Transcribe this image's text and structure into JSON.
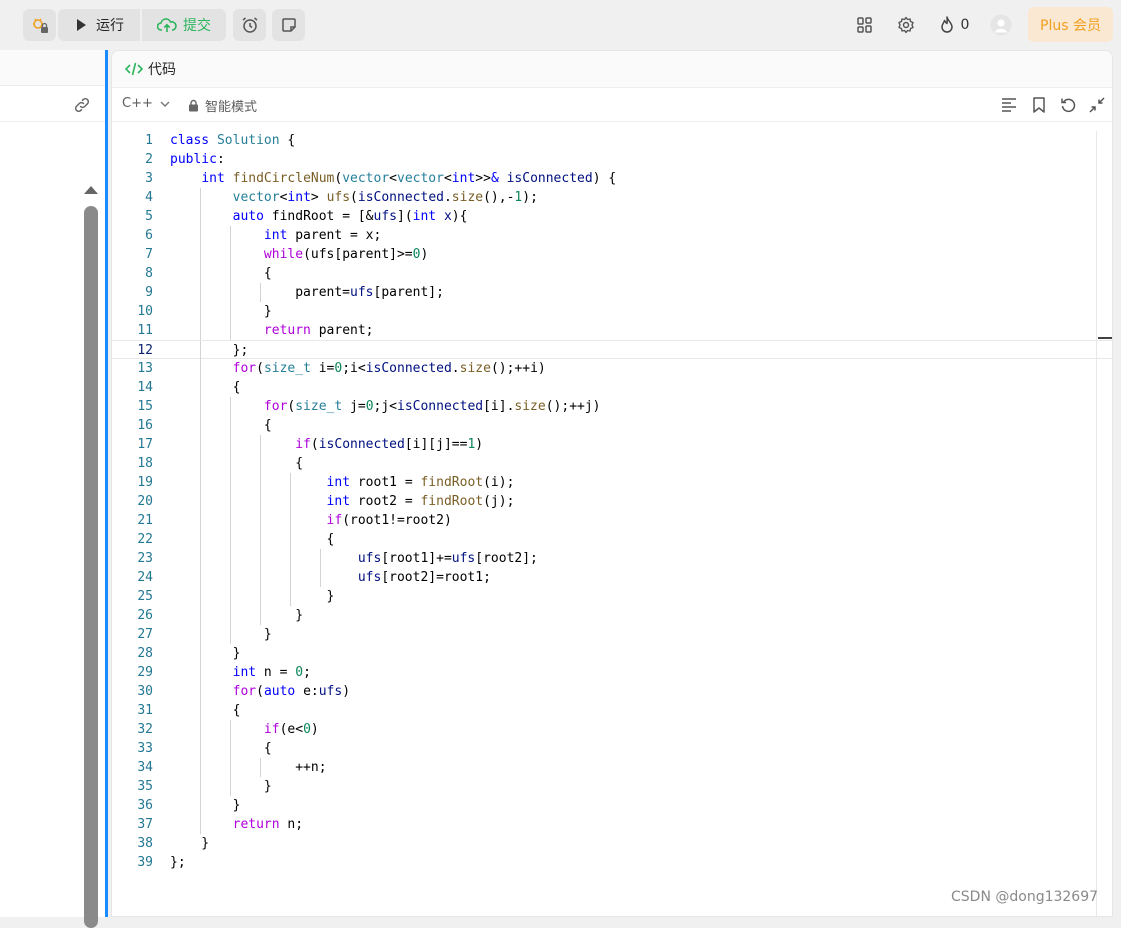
{
  "toolbar": {
    "run_label": "运行",
    "submit_label": "提交",
    "streak_count": "0",
    "plus_label": "Plus 会员"
  },
  "editor": {
    "title": "代码",
    "language": "C++",
    "mode": "智能模式",
    "active_line": 12,
    "lines": [
      {
        "n": "1",
        "indent": 0,
        "html": "<span class=\"kw\">class</span> <span class=\"ty\">Solution</span> {"
      },
      {
        "n": "2",
        "indent": 0,
        "html": "<span class=\"kw\">public</span>:"
      },
      {
        "n": "3",
        "indent": 1,
        "html": "    <span class=\"kw\">int</span> <span class=\"fn\">findCircleNum</span>(<span class=\"ty\">vector</span>&lt;<span class=\"ty\">vector</span>&lt;<span class=\"kw\">int</span>&gt;&gt;<span class=\"kw\">&amp;</span> <span class=\"var\">isConnected</span>) {"
      },
      {
        "n": "4",
        "indent": 2,
        "html": "        <span class=\"ty\">vector</span>&lt;<span class=\"kw\">int</span>&gt; <span class=\"fn\">ufs</span>(<span class=\"var\">isConnected</span>.<span class=\"fn\">size</span>(),-<span class=\"num\">1</span>);"
      },
      {
        "n": "5",
        "indent": 2,
        "html": "        <span class=\"kw\">auto</span> findRoot = [&amp;<span class=\"var\">ufs</span>](<span class=\"kw\">int</span> <span class=\"var\">x</span>){"
      },
      {
        "n": "6",
        "indent": 3,
        "html": "            <span class=\"kw\">int</span> parent = x;"
      },
      {
        "n": "7",
        "indent": 3,
        "html": "            <span class=\"ctl\">while</span>(ufs[parent]&gt;=<span class=\"num\">0</span>)"
      },
      {
        "n": "8",
        "indent": 3,
        "html": "            {"
      },
      {
        "n": "9",
        "indent": 4,
        "html": "                parent=<span class=\"var\">ufs</span>[parent];"
      },
      {
        "n": "10",
        "indent": 3,
        "html": "            }"
      },
      {
        "n": "11",
        "indent": 3,
        "html": "            <span class=\"ctl\">return</span> parent;"
      },
      {
        "n": "12",
        "indent": 2,
        "html": "        };"
      },
      {
        "n": "13",
        "indent": 2,
        "html": "        <span class=\"ctl\">for</span>(<span class=\"ty\">size_t</span> i=<span class=\"num\">0</span>;i&lt;<span class=\"var\">isConnected</span>.<span class=\"fn\">size</span>();++i)"
      },
      {
        "n": "14",
        "indent": 2,
        "html": "        {"
      },
      {
        "n": "15",
        "indent": 3,
        "html": "            <span class=\"ctl\">for</span>(<span class=\"ty\">size_t</span> j=<span class=\"num\">0</span>;j&lt;<span class=\"var\">isConnected</span>[i].<span class=\"fn\">size</span>();++j)"
      },
      {
        "n": "16",
        "indent": 3,
        "html": "            {"
      },
      {
        "n": "17",
        "indent": 4,
        "html": "                <span class=\"ctl\">if</span>(<span class=\"var\">isConnected</span>[i][j]==<span class=\"num\">1</span>)"
      },
      {
        "n": "18",
        "indent": 4,
        "html": "                {"
      },
      {
        "n": "19",
        "indent": 5,
        "html": "                    <span class=\"kw\">int</span> root1 = <span class=\"fn\">findRoot</span>(i);"
      },
      {
        "n": "20",
        "indent": 5,
        "html": "                    <span class=\"kw\">int</span> root2 = <span class=\"fn\">findRoot</span>(j);"
      },
      {
        "n": "21",
        "indent": 5,
        "html": "                    <span class=\"ctl\">if</span>(root1!=root2)"
      },
      {
        "n": "22",
        "indent": 5,
        "html": "                    {"
      },
      {
        "n": "23",
        "indent": 6,
        "html": "                        <span class=\"var\">ufs</span>[root1]+=<span class=\"var\">ufs</span>[root2];"
      },
      {
        "n": "24",
        "indent": 6,
        "html": "                        <span class=\"var\">ufs</span>[root2]=root1;"
      },
      {
        "n": "25",
        "indent": 5,
        "html": "                    }"
      },
      {
        "n": "26",
        "indent": 4,
        "html": "                }"
      },
      {
        "n": "27",
        "indent": 3,
        "html": "            }"
      },
      {
        "n": "28",
        "indent": 2,
        "html": "        }"
      },
      {
        "n": "29",
        "indent": 2,
        "html": "        <span class=\"kw\">int</span> n = <span class=\"num\">0</span>;"
      },
      {
        "n": "30",
        "indent": 2,
        "html": "        <span class=\"ctl\">for</span>(<span class=\"kw\">auto</span> e:<span class=\"var\">ufs</span>)"
      },
      {
        "n": "31",
        "indent": 2,
        "html": "        {"
      },
      {
        "n": "32",
        "indent": 3,
        "html": "            <span class=\"ctl\">if</span>(e&lt;<span class=\"num\">0</span>)"
      },
      {
        "n": "33",
        "indent": 3,
        "html": "            {"
      },
      {
        "n": "34",
        "indent": 4,
        "html": "                ++n;"
      },
      {
        "n": "35",
        "indent": 3,
        "html": "            }"
      },
      {
        "n": "36",
        "indent": 2,
        "html": "        }"
      },
      {
        "n": "37",
        "indent": 2,
        "html": "        <span class=\"ctl\">return</span> n;"
      },
      {
        "n": "38",
        "indent": 1,
        "html": "    }"
      },
      {
        "n": "39",
        "indent": 0,
        "html": "};"
      }
    ]
  },
  "watermark": "CSDN @dong132697",
  "colors": {
    "accent": "#1a8cff",
    "submit_green": "#2db55d",
    "plus_orange": "#f0a020",
    "line_number": "#237893"
  }
}
